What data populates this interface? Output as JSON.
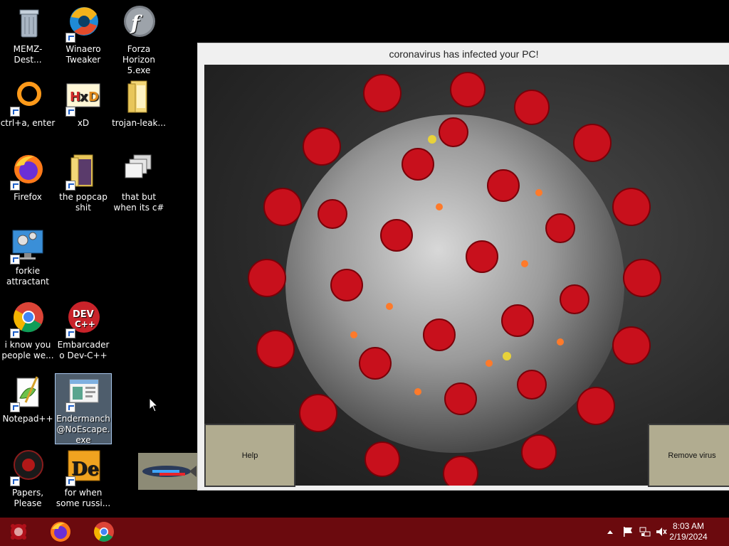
{
  "desktop": {
    "icons": [
      {
        "label": "MEMZ-Dest...",
        "icon": "recycle-bin-icon"
      },
      {
        "label": "Winaero Tweaker",
        "icon": "winaero-icon"
      },
      {
        "label": "Forza Horizon 5.exe",
        "icon": "flash-player-icon"
      },
      {
        "label": "ctrl+a, enter",
        "icon": "ring-icon"
      },
      {
        "label": "xD",
        "icon": "hxd-icon"
      },
      {
        "label": "trojan-leak...",
        "icon": "folder-icon"
      },
      {
        "label": "Firefox",
        "icon": "firefox-icon"
      },
      {
        "label": "the popcap shit",
        "icon": "folder-icon"
      },
      {
        "label": "that but when its c#",
        "icon": "windows-stack-icon"
      },
      {
        "label": "forkie attractant",
        "icon": "settings-monitor-icon"
      },
      {
        "label": "i know you people we...",
        "icon": "chrome-icon"
      },
      {
        "label": "Embarcadero Dev-C++",
        "icon": "devcpp-icon"
      },
      {
        "label": "Notepad++",
        "icon": "notepad-plus-icon"
      },
      {
        "label": "Endermanch@NoEscape.exe",
        "icon": "app-window-icon"
      },
      {
        "label": "Papers, Please",
        "icon": "papers-please-icon"
      },
      {
        "label": "for when some russi...",
        "icon": "de-icon"
      }
    ]
  },
  "virus_window": {
    "title": "coronavirus has infected your PC!",
    "help_label": "Help",
    "remove_label": "Remove virus"
  },
  "taskbar": {
    "time": "8:03 AM",
    "date": "2/19/2024",
    "pinned": [
      "virus-start-icon",
      "firefox-icon",
      "chrome-icon"
    ],
    "tray": [
      "show-hidden-icon",
      "flag-icon",
      "network-icon",
      "volume-muted-icon"
    ]
  },
  "colors": {
    "taskbar": "#6b0a0e",
    "window_bg": "#f0f0f0",
    "button": "#b1ac90",
    "virus_red": "#c8101c"
  }
}
